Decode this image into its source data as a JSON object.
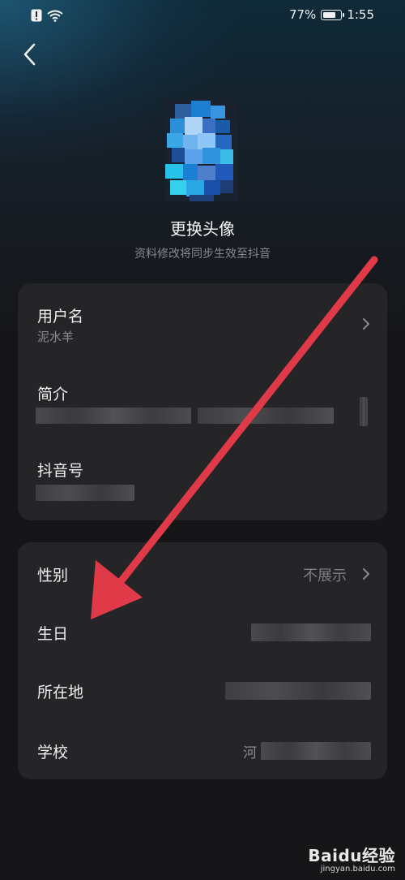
{
  "status_bar": {
    "battery_percent": "77%",
    "battery_level": 0.77,
    "time": "1:55"
  },
  "header": {
    "back_icon": "chevron-left-icon"
  },
  "avatar": {
    "change_label": "更换头像",
    "sync_note": "资料修改将同步生效至抖音"
  },
  "profile_card": {
    "username": {
      "label": "用户名",
      "value": "泥水羊"
    },
    "bio": {
      "label": "简介"
    },
    "douyin_id": {
      "label": "抖音号"
    }
  },
  "info_card": {
    "gender": {
      "label": "性别",
      "value": "不展示"
    },
    "birthday": {
      "label": "生日"
    },
    "location": {
      "label": "所在地"
    },
    "school": {
      "label": "学校",
      "value_prefix": "河"
    }
  },
  "watermark": {
    "logo": "Baidu经验",
    "url": "jingyan.baidu.com"
  },
  "colors": {
    "background": "#161618",
    "card": "#252527",
    "arrow": "#e03a48",
    "secondary_text": "#8a8a8e"
  }
}
